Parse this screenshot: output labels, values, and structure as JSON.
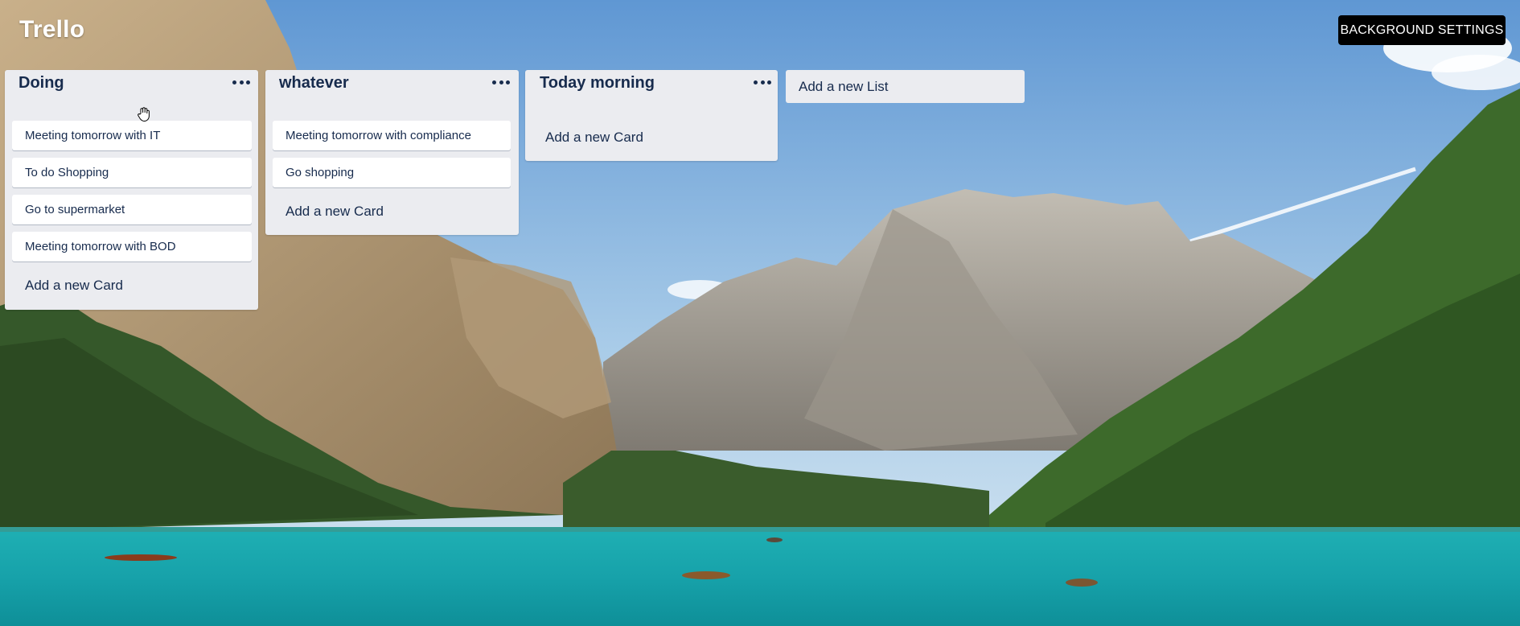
{
  "app": {
    "brand": "Trello"
  },
  "header": {
    "background_settings_label": "BACKGROUND SETTINGS"
  },
  "lists": [
    {
      "title": "Doing",
      "cards": [
        "Meeting tomorrow with IT",
        "To do Shopping",
        "Go to supermarket",
        "Meeting tomorrow with BOD"
      ],
      "add_card_label": "Add a new Card"
    },
    {
      "title": "whatever",
      "cards": [
        "Meeting tomorrow with compliance",
        "Go shopping"
      ],
      "add_card_label": "Add a new Card"
    },
    {
      "title": "Today morning",
      "cards": [],
      "add_card_label": "Add a new Card"
    }
  ],
  "add_list_label": "Add a new List",
  "icons": {
    "list_menu": "more-horizontal-icon",
    "cursor": "grab-hand-icon"
  },
  "colors": {
    "list_bg": "#ebecf0",
    "card_bg": "#ffffff",
    "text": "#172b4d",
    "button_bg": "#000000",
    "button_text": "#ffffff"
  }
}
